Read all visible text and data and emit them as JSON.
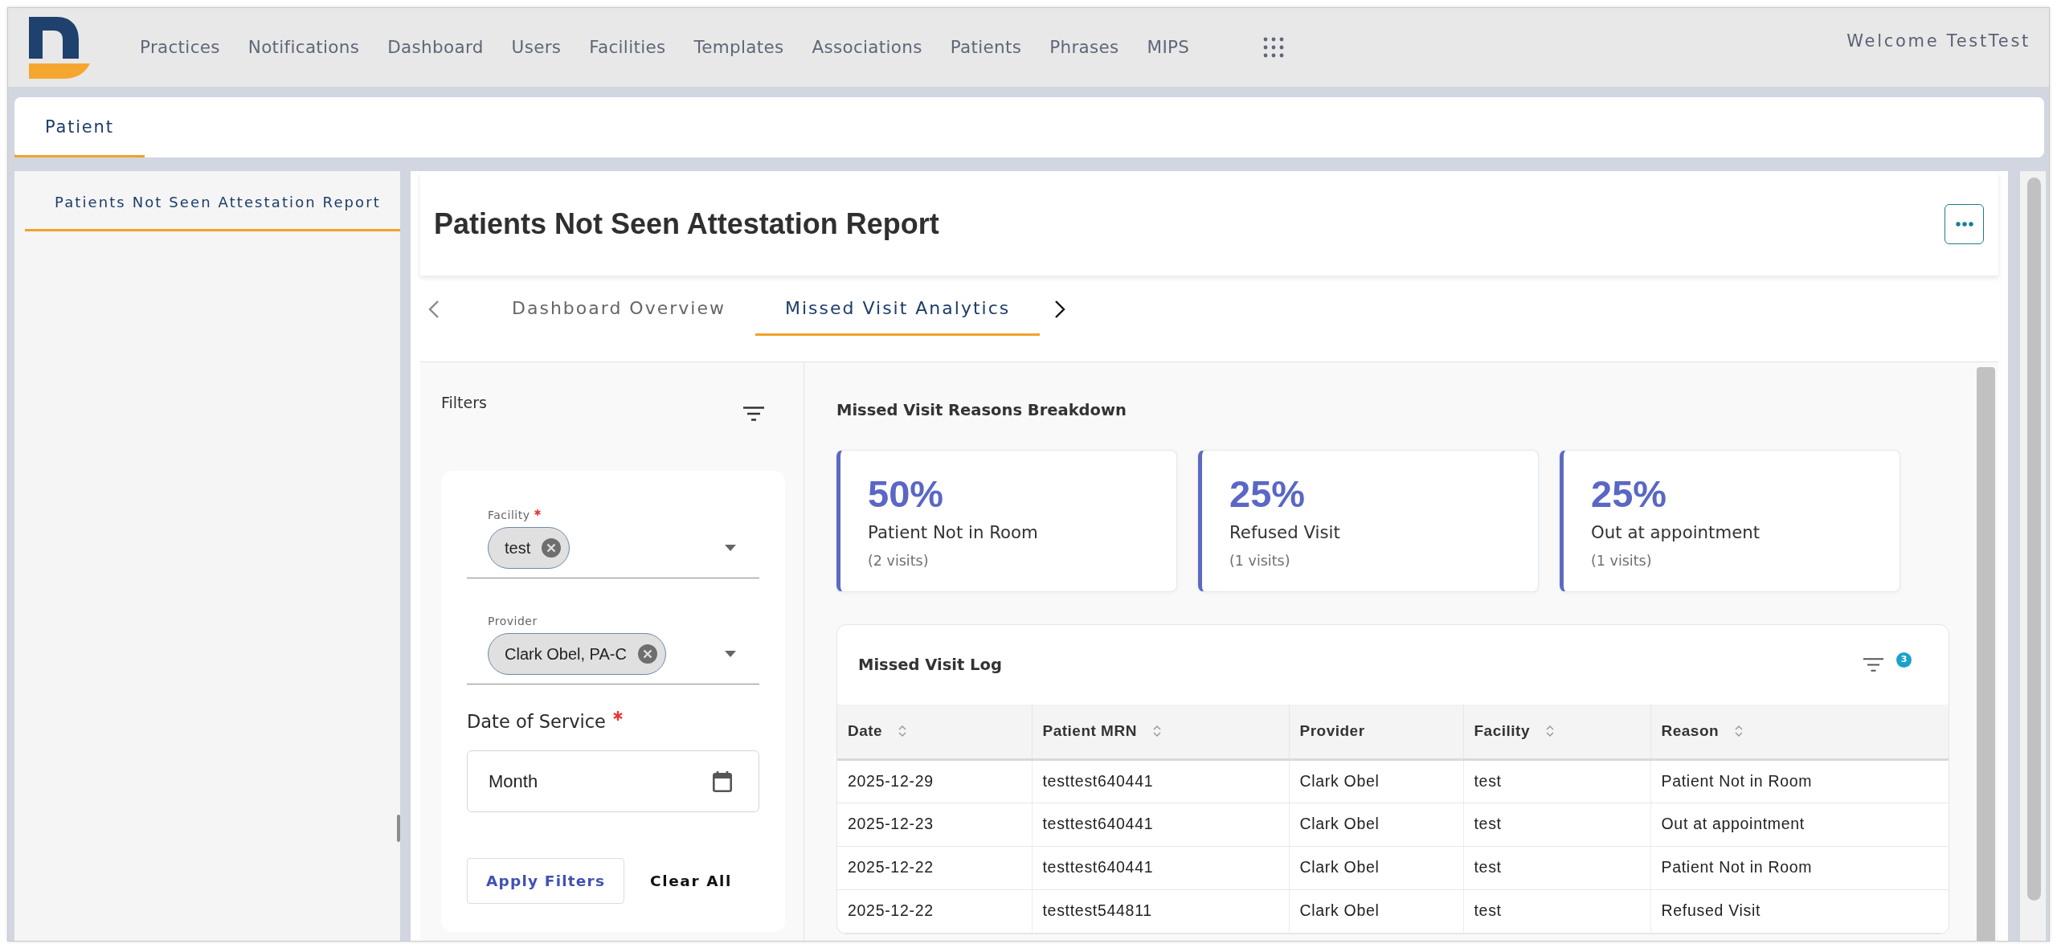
{
  "header": {
    "nav_items": [
      {
        "label": "Practices",
        "selected": false
      },
      {
        "label": "Notifications",
        "selected": false
      },
      {
        "label": "Dashboard",
        "selected": false
      },
      {
        "label": "Users",
        "selected": false
      },
      {
        "label": "Facilities",
        "selected": false
      },
      {
        "label": "Templates",
        "selected": false
      },
      {
        "label": "Associations",
        "selected": false
      },
      {
        "label": "Patients",
        "selected": false
      },
      {
        "label": "Phrases",
        "selected": false
      },
      {
        "label": "MIPS",
        "selected": false
      }
    ],
    "welcome": "Welcome TestTest"
  },
  "page_tabs": [
    {
      "label": "Patient",
      "selected": true
    }
  ],
  "sidebar": {
    "items": [
      {
        "label": "Patients Not Seen Attestation Report",
        "selected": true
      }
    ]
  },
  "report": {
    "title": "Patients Not Seen Attestation Report",
    "tabs": [
      {
        "label": "Dashboard Overview",
        "selected": false
      },
      {
        "label": "Missed Visit Analytics",
        "selected": true
      }
    ]
  },
  "filters": {
    "title": "Filters",
    "fields": [
      {
        "kind": "chip_select",
        "label": "Facility",
        "required": true,
        "chips": [
          "test"
        ]
      },
      {
        "kind": "chip_select",
        "label": "Provider",
        "required": false,
        "chips": [
          "Clark Obel, PA-C"
        ]
      },
      {
        "kind": "date",
        "label": "Date of Service",
        "required": true,
        "value": "Month"
      }
    ],
    "buttons": [
      {
        "kind": "outline",
        "label": "Apply Filters"
      },
      {
        "kind": "text",
        "label": "Clear All"
      }
    ]
  },
  "breakdown": {
    "title": "Missed Visit Reasons Breakdown",
    "cards": [
      {
        "percent": "50%",
        "reason": "Patient Not in Room",
        "visits": "(2 visits)"
      },
      {
        "percent": "25%",
        "reason": "Refused Visit",
        "visits": "(1 visits)"
      },
      {
        "percent": "25%",
        "reason": "Out at appointment",
        "visits": "(1 visits)"
      }
    ]
  },
  "visit_log": {
    "title": "Missed Visit Log",
    "filter_count": "3",
    "columns": [
      {
        "label": "Date",
        "sortable": true
      },
      {
        "label": "Patient MRN",
        "sortable": true
      },
      {
        "label": "Provider",
        "sortable": false
      },
      {
        "label": "Facility",
        "sortable": true
      },
      {
        "label": "Reason",
        "sortable": true
      }
    ],
    "rows": [
      [
        "2025-12-29",
        "testtest640441",
        "Clark Obel",
        "test",
        "Patient Not in Room"
      ],
      [
        "2025-12-23",
        "testtest640441",
        "Clark Obel",
        "test",
        "Out at appointment"
      ],
      [
        "2025-12-22",
        "testtest640441",
        "Clark Obel",
        "test",
        "Patient Not in Room"
      ],
      [
        "2025-12-22",
        "testtest544811",
        "Clark Obel",
        "test",
        "Refused Visit"
      ]
    ]
  }
}
